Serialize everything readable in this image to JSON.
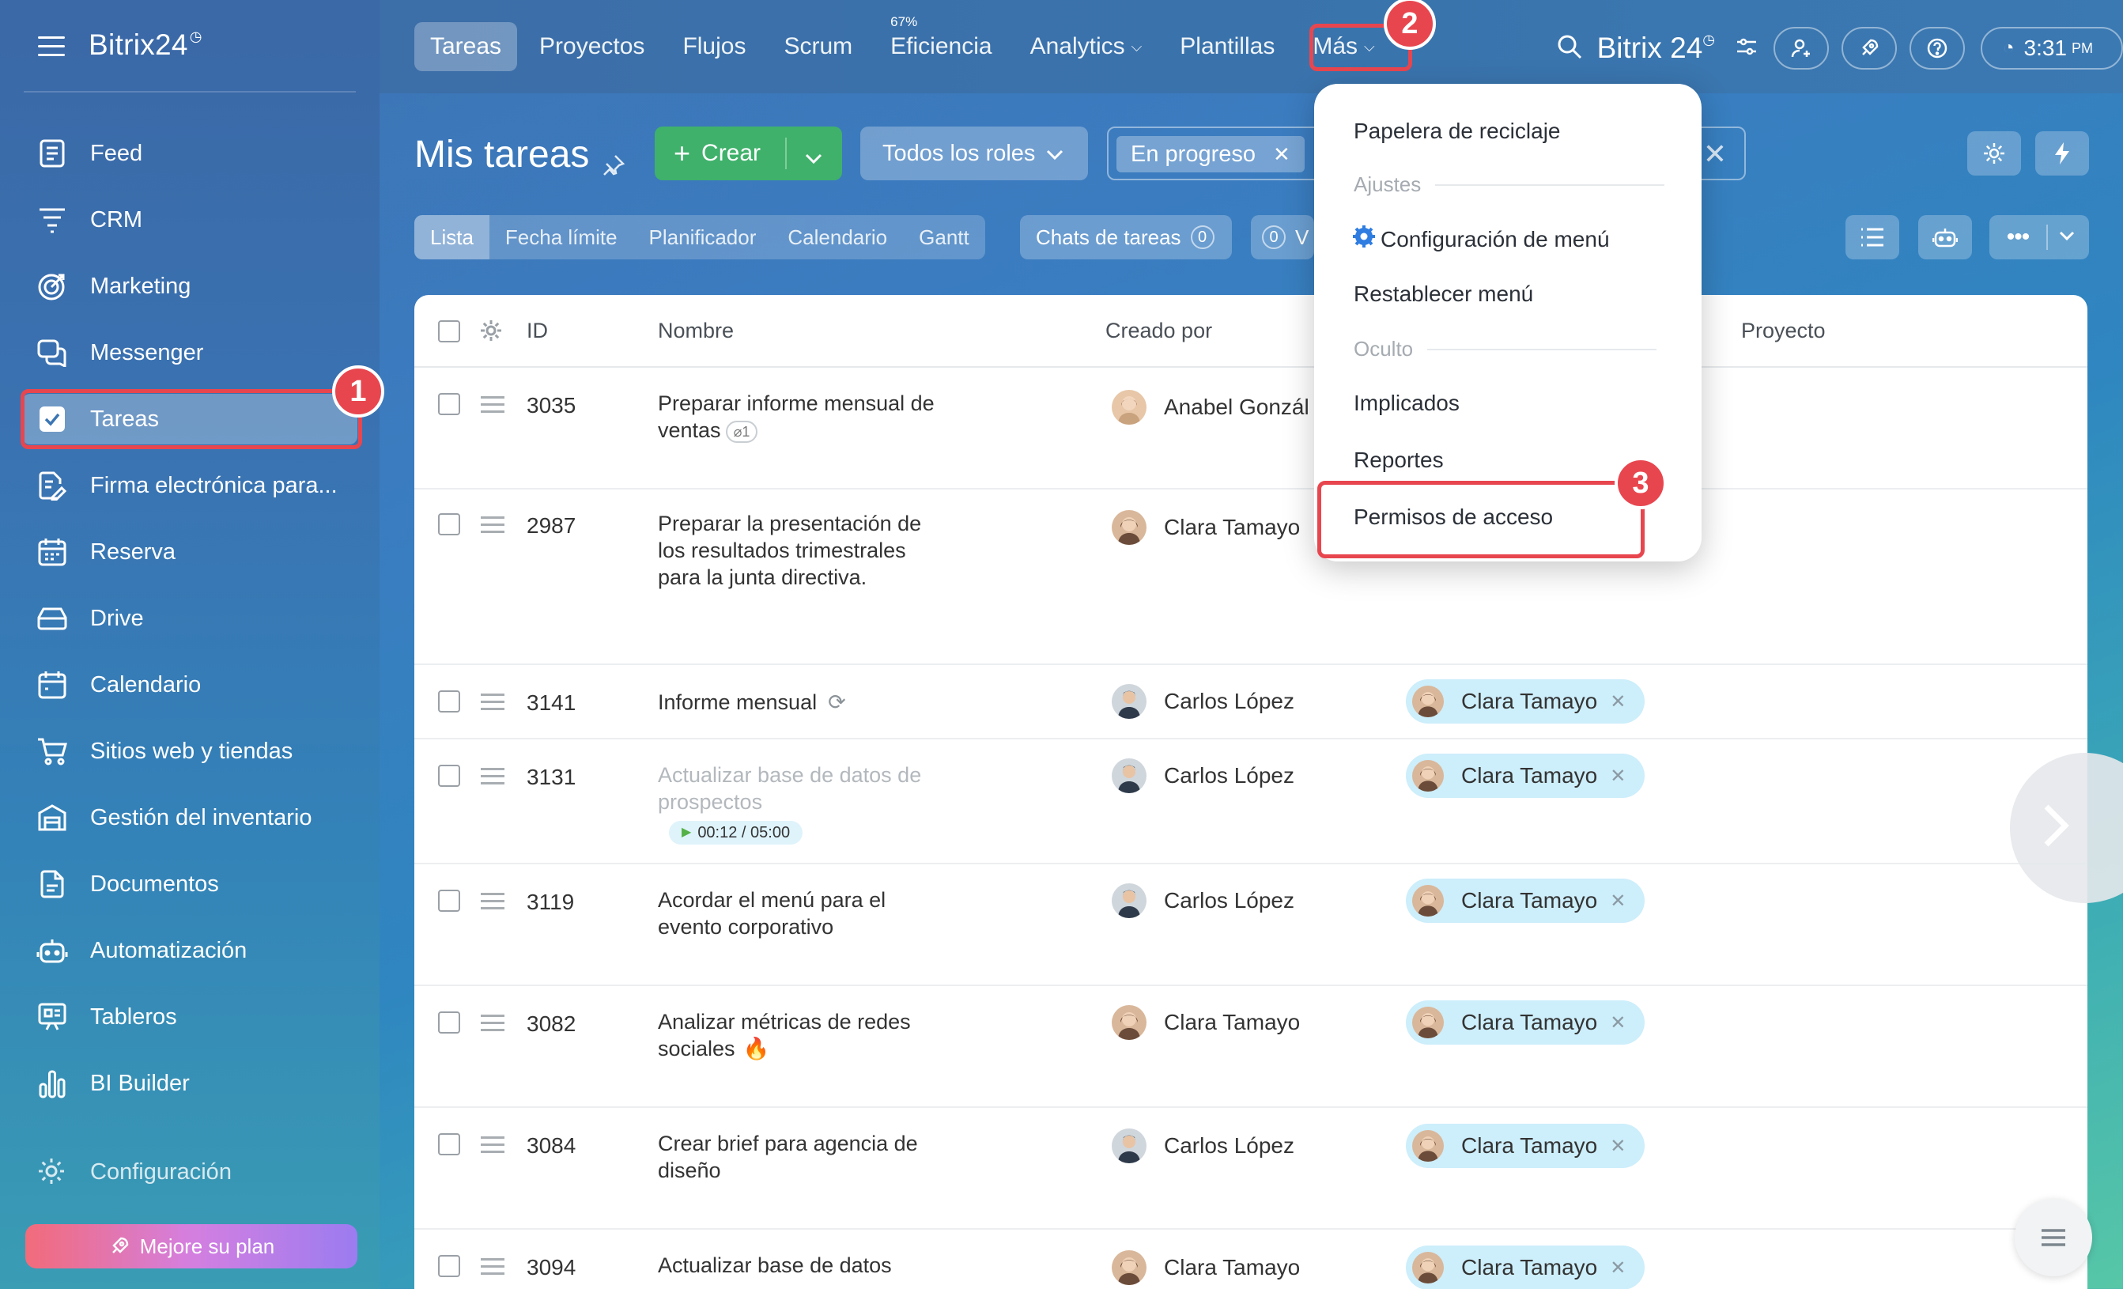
{
  "app": {
    "logo": "Bitrix24",
    "brand": "Bitrix 24"
  },
  "sidebar": {
    "items": [
      {
        "label": "Feed",
        "icon": "feed-icon"
      },
      {
        "label": "CRM",
        "icon": "crm-filter-icon"
      },
      {
        "label": "Marketing",
        "icon": "marketing-target-icon"
      },
      {
        "label": "Messenger",
        "icon": "messenger-icon"
      },
      {
        "label": "Tareas",
        "icon": "tasks-check-icon",
        "active": true
      },
      {
        "label": "Firma electrónica para...",
        "icon": "e-signature-icon"
      },
      {
        "label": "Reserva",
        "icon": "booking-calendar-icon"
      },
      {
        "label": "Drive",
        "icon": "drive-icon"
      },
      {
        "label": "Calendario",
        "icon": "calendar-icon"
      },
      {
        "label": "Sitios web y tiendas",
        "icon": "cart-icon"
      },
      {
        "label": "Gestión del inventario",
        "icon": "inventory-icon"
      },
      {
        "label": "Documentos",
        "icon": "document-icon"
      },
      {
        "label": "Automatización",
        "icon": "robot-icon"
      },
      {
        "label": "Tableros",
        "icon": "boards-icon"
      },
      {
        "label": "BI Builder",
        "icon": "bar-chart-icon"
      }
    ],
    "config_label": "Configuración",
    "upgrade_label": "Mejore su plan"
  },
  "topnav": {
    "tabs": [
      {
        "label": "Tareas",
        "active": true
      },
      {
        "label": "Proyectos"
      },
      {
        "label": "Flujos"
      },
      {
        "label": "Scrum"
      },
      {
        "label": "Eficiencia",
        "badge": "67%"
      },
      {
        "label": "Analytics",
        "caret": true
      },
      {
        "label": "Plantillas"
      },
      {
        "label": "Más",
        "caret": true
      }
    ],
    "time": "3:31",
    "ampm": "PM"
  },
  "page": {
    "title": "Mis tareas",
    "create_label": "Crear",
    "roles_label": "Todos los roles",
    "filter_chip": "En progreso"
  },
  "views": {
    "tabs": [
      "Lista",
      "Fecha límite",
      "Planificador",
      "Calendario",
      "Gantt"
    ],
    "chats_label": "Chats de tareas",
    "chats_count": "0",
    "chats2_count": "0",
    "chats2_label": "V"
  },
  "table": {
    "columns": [
      "ID",
      "Nombre",
      "Creado por",
      "Proyecto"
    ],
    "rows": [
      {
        "id": "3035",
        "name": "Preparar informe mensual de ventas",
        "attach": "1",
        "creator": "Anabel Gonzál",
        "avatar": "female",
        "responsible": ""
      },
      {
        "id": "2987",
        "name": "Preparar la presentación de los resultados trimestrales para la junta directiva.",
        "creator": "Clara Tamayo",
        "avatar": "female",
        "responsible": ""
      },
      {
        "id": "3141",
        "name": "Informe mensual",
        "repeat": true,
        "creator": "Carlos López",
        "avatar": "male",
        "responsible": "Clara Tamayo"
      },
      {
        "id": "3131",
        "name": "Actualizar base de datos de prospectos",
        "muted": true,
        "timer": "00:12 / 05:00",
        "creator": "Carlos López",
        "avatar": "male",
        "responsible": "Clara Tamayo"
      },
      {
        "id": "3119",
        "name": "Acordar el menú para el evento corporativo",
        "creator": "Carlos López",
        "avatar": "male",
        "responsible": "Clara Tamayo"
      },
      {
        "id": "3082",
        "name": "Analizar métricas de redes sociales",
        "fire": true,
        "creator": "Clara Tamayo",
        "avatar": "female",
        "responsible": "Clara Tamayo"
      },
      {
        "id": "3084",
        "name": "Crear brief para agencia de diseño",
        "creator": "Carlos López",
        "avatar": "male",
        "responsible": "Clara Tamayo"
      },
      {
        "id": "3094",
        "name": "Actualizar base de datos",
        "creator": "Clara Tamayo",
        "avatar": "female",
        "responsible": "Clara Tamayo"
      }
    ]
  },
  "dropdown": {
    "recycle": "Papelera de reciclaje",
    "settings_header": "Ajustes",
    "menu_config": "Configuración de menú",
    "reset_menu": "Restablecer menú",
    "hidden_header": "Oculto",
    "involved": "Implicados",
    "reports": "Reportes",
    "permissions": "Permisos de acceso"
  },
  "callouts": {
    "one": "1",
    "two": "2",
    "three": "3"
  },
  "colors": {
    "accent": "#e8464f",
    "green": "#3fb16b",
    "chip": "#cdeefb"
  }
}
